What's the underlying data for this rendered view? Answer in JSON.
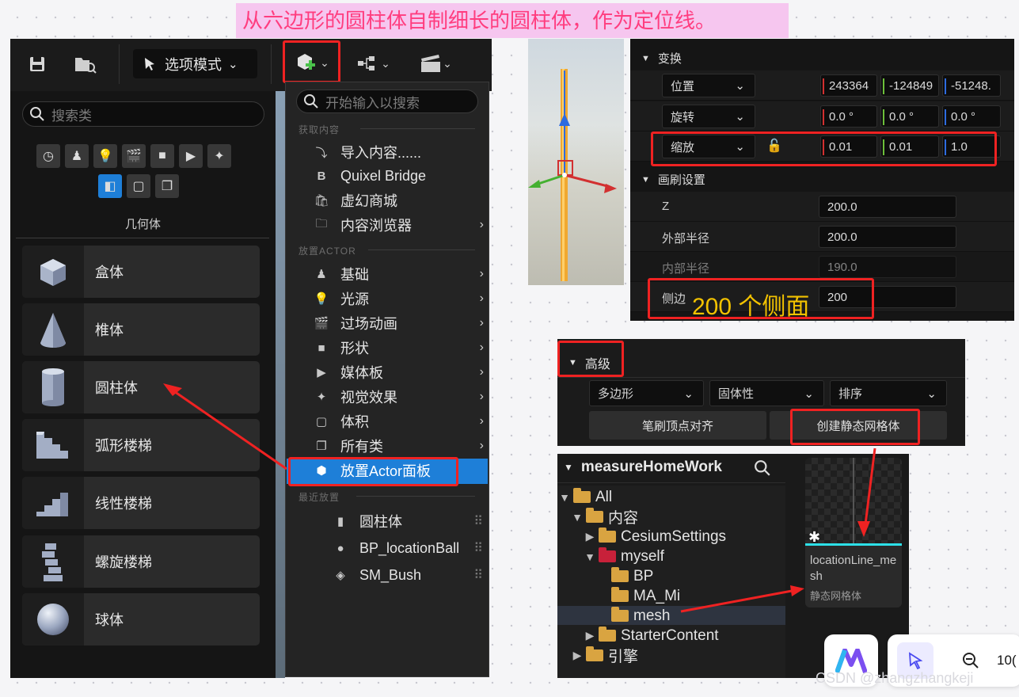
{
  "caption": "从六边形的圆柱体自制细长的圆柱体，作为定位线。",
  "toolbar": {
    "mode_label": "选项模式",
    "chevron": "⌄",
    "icons": [
      "save-icon",
      "browse-icon",
      "mode-icon",
      "add-actor-icon",
      "blueprint-icon",
      "cinematics-icon"
    ]
  },
  "shapes_panel": {
    "search_placeholder": "搜索类",
    "category_title": "几何体",
    "items": [
      "盒体",
      "椎体",
      "圆柱体",
      "弧形楼梯",
      "线性楼梯",
      "螺旋楼梯",
      "球体"
    ]
  },
  "menu": {
    "search_placeholder": "开始输入以搜索",
    "section_get": "获取内容",
    "get_items": [
      "导入内容......",
      "Quixel Bridge",
      "虚幻商城",
      "内容浏览器"
    ],
    "section_place": "放置ACTOR",
    "place_items": [
      "基础",
      "光源",
      "过场动画",
      "形状",
      "媒体板",
      "视觉效果",
      "体积",
      "所有类"
    ],
    "selected_item": "放置Actor面板",
    "section_recent": "最近放置",
    "recent_items": [
      "圆柱体",
      "BP_locationBall",
      "SM_Bush"
    ]
  },
  "details": {
    "transform_header": "变换",
    "position_label": "位置",
    "position_values": [
      "243364",
      "-124849",
      "-51248."
    ],
    "rotation_label": "旋转",
    "rotation_values": [
      "0.0 °",
      "0.0 °",
      "0.0 °"
    ],
    "scale_label": "缩放",
    "scale_values": [
      "0.01",
      "0.01",
      "1.0"
    ],
    "brush_header": "画刷设置",
    "z_label": "Z",
    "z_value": "200.0",
    "outer_radius_label": "外部半径",
    "outer_radius_value": "200.0",
    "inner_radius_label": "内部半径",
    "inner_radius_value": "190.0",
    "sides_label": "侧边",
    "sides_value": "200",
    "sides_annotation": "200 个侧面"
  },
  "advanced": {
    "header": "高级",
    "dropdowns": [
      "多边形",
      "固体性",
      "排序"
    ],
    "align_button": "笔刷顶点对齐",
    "create_mesh_button": "创建静态网格体"
  },
  "content_browser": {
    "title": "measureHomeWork",
    "tree": {
      "all": "All",
      "content": "内容",
      "cesium": "CesiumSettings",
      "myself": "myself",
      "bp": "BP",
      "ma": "MA_Mi",
      "mesh": "mesh",
      "starter": "StarterContent",
      "engine": "引擎"
    },
    "asset_name": "locationLine_mesh",
    "asset_type": "静态网格体"
  },
  "zoom_label": "10(",
  "watermark": "CSDN @zhangzhangkeji",
  "colors": {
    "accent_blue": "#1e7fd8",
    "annotation_red": "#ef2222",
    "caption_bg": "#f6c6ef",
    "caption_text": "#ff3d7f",
    "annotation_yellow": "#f2c200"
  }
}
